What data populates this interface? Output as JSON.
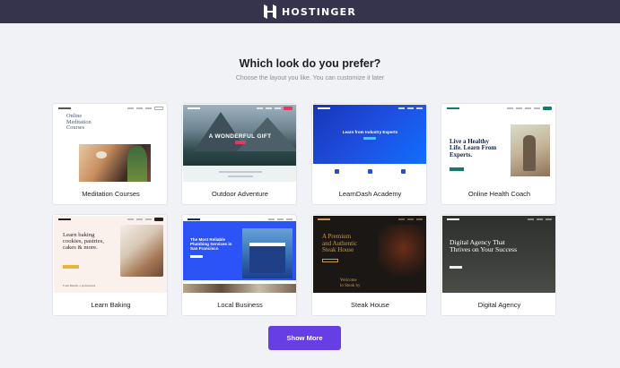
{
  "header": {
    "brand": "HOSTINGER"
  },
  "main": {
    "title": "Which look do you prefer?",
    "subtitle": "Choose the layout you like. You can customize it later",
    "show_more_label": "Show More"
  },
  "templates": [
    {
      "label": "Meditation Courses",
      "preview_title_1": "Online",
      "preview_title_2": "Meditation",
      "preview_title_3": "Courses"
    },
    {
      "label": "Outdoor Adventure",
      "preview_title": "A WONDERFUL GIFT"
    },
    {
      "label": "LearnDash Academy",
      "preview_title": "Learn from Industry Experts"
    },
    {
      "label": "Online Health Coach",
      "preview_title_1": "Live a Healthy",
      "preview_title_2": "Life. Learn From",
      "preview_title_3": "Experts."
    },
    {
      "label": "Learn Baking",
      "preview_title_1": "Learn baking",
      "preview_title_2": "cookies, pastries,",
      "preview_title_3": "cakes & more.",
      "preview_footer": "From Bibelle, a professional"
    },
    {
      "label": "Local Business",
      "preview_title_1": "The Most Reliable",
      "preview_title_2": "Plumbing Services in",
      "preview_title_3": "San Francisco"
    },
    {
      "label": "Steak House",
      "preview_title_1": "A Premium",
      "preview_title_2": "and Authentic",
      "preview_title_3": "Steak House",
      "preview_sub_1": "Welcome",
      "preview_sub_2": "to Steak hy"
    },
    {
      "label": "Digital Agency",
      "preview_title_1": "Digital Agency That",
      "preview_title_2": "Thrives on Your Success"
    }
  ],
  "colors": {
    "topbar": "#36344d",
    "accent": "#673de6"
  }
}
